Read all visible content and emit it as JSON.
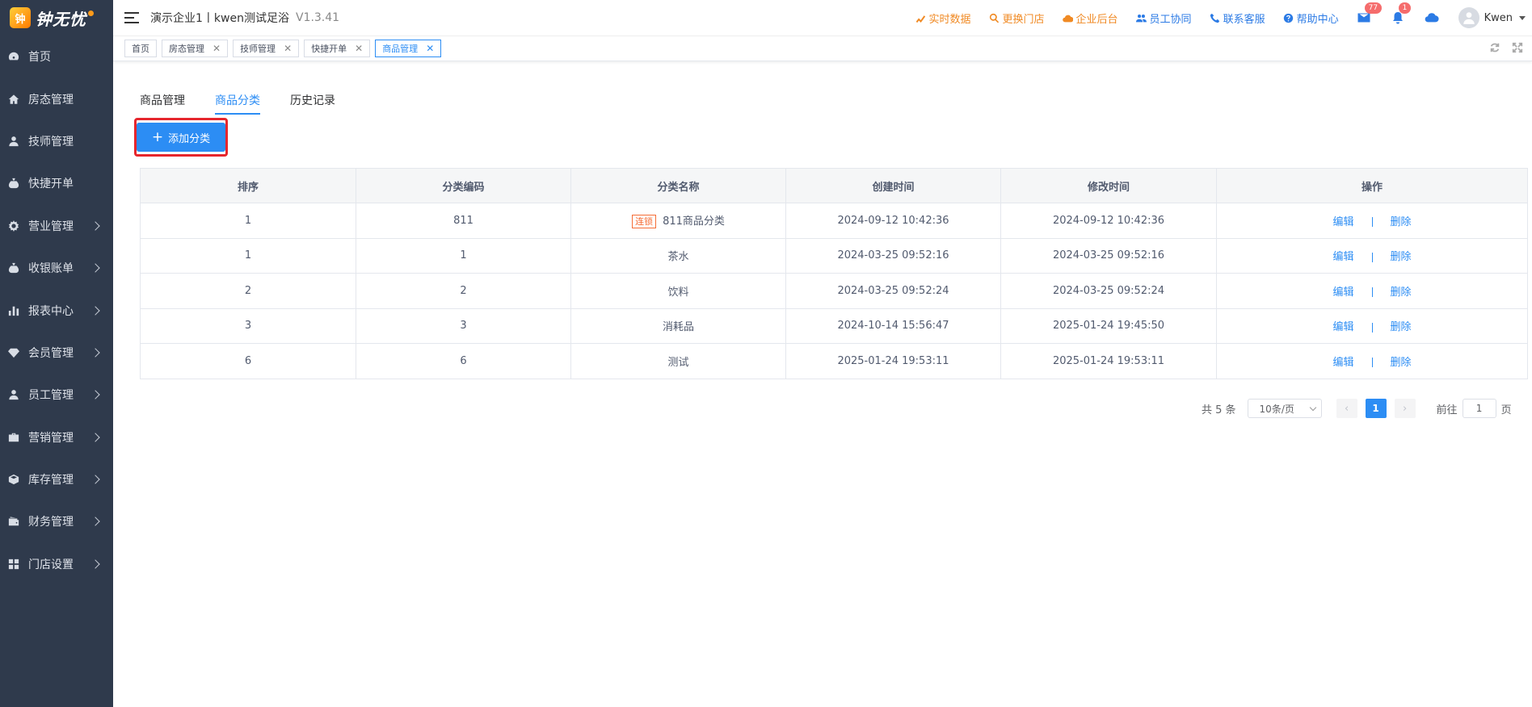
{
  "brand": {
    "logo_badge": "钟",
    "name": "钟无忧"
  },
  "sidebar": {
    "items": [
      {
        "label": "首页",
        "icon": "dashboard-icon",
        "has_submenu": false
      },
      {
        "label": "房态管理",
        "icon": "home-icon",
        "has_submenu": false
      },
      {
        "label": "技师管理",
        "icon": "user-icon",
        "has_submenu": false
      },
      {
        "label": "快捷开单",
        "icon": "bag-icon",
        "has_submenu": false
      },
      {
        "label": "营业管理",
        "icon": "gear-icon",
        "has_submenu": true
      },
      {
        "label": "收银账单",
        "icon": "money-bag-icon",
        "has_submenu": true
      },
      {
        "label": "报表中心",
        "icon": "bar-chart-icon",
        "has_submenu": true
      },
      {
        "label": "会员管理",
        "icon": "diamond-icon",
        "has_submenu": true
      },
      {
        "label": "员工管理",
        "icon": "staff-icon",
        "has_submenu": true
      },
      {
        "label": "营销管理",
        "icon": "briefcase-icon",
        "has_submenu": true
      },
      {
        "label": "库存管理",
        "icon": "box-icon",
        "has_submenu": true
      },
      {
        "label": "财务管理",
        "icon": "wallet-icon",
        "has_submenu": true
      },
      {
        "label": "门店设置",
        "icon": "grid-icon",
        "has_submenu": true
      }
    ]
  },
  "header": {
    "company": "演示企业1丨kwen测试足浴",
    "version": "V1.3.41",
    "links": [
      {
        "label": "实时数据",
        "icon": "realtime-chart-icon",
        "color": "#f08a24"
      },
      {
        "label": "更换门店",
        "icon": "search-icon",
        "color": "#f08a24"
      },
      {
        "label": "企业后台",
        "icon": "cloud-icon",
        "color": "#f08a24"
      },
      {
        "label": "员工协同",
        "icon": "team-icon",
        "color": "#2c7be5"
      },
      {
        "label": "联系客服",
        "icon": "phone-icon",
        "color": "#2c7be5"
      },
      {
        "label": "帮助中心",
        "icon": "help-icon",
        "color": "#2c7be5"
      }
    ],
    "mail_count": "77",
    "notice_count": "1",
    "username": "Kwen"
  },
  "visited_tabs": [
    {
      "label": "首页",
      "closable": false,
      "active": false
    },
    {
      "label": "房态管理",
      "closable": true,
      "active": false
    },
    {
      "label": "技师管理",
      "closable": true,
      "active": false
    },
    {
      "label": "快捷开单",
      "closable": true,
      "active": false
    },
    {
      "label": "商品管理",
      "closable": true,
      "active": true
    }
  ],
  "tabs": [
    {
      "label": "商品管理",
      "active": false
    },
    {
      "label": "商品分类",
      "active": true
    },
    {
      "label": "历史记录",
      "active": false
    }
  ],
  "add_button": "添加分类",
  "table": {
    "columns": [
      "排序",
      "分类编码",
      "分类名称",
      "创建时间",
      "修改时间",
      "操作"
    ],
    "rows": [
      {
        "sort": "1",
        "code": "811",
        "tag": "连锁",
        "name": "811商品分类",
        "created": "2024-09-12 10:42:36",
        "modified": "2024-09-12 10:42:36"
      },
      {
        "sort": "1",
        "code": "1",
        "tag": "",
        "name": "茶水",
        "created": "2024-03-25 09:52:16",
        "modified": "2024-03-25 09:52:16"
      },
      {
        "sort": "2",
        "code": "2",
        "tag": "",
        "name": "饮料",
        "created": "2024-03-25 09:52:24",
        "modified": "2024-03-25 09:52:24"
      },
      {
        "sort": "3",
        "code": "3",
        "tag": "",
        "name": "消耗品",
        "created": "2024-10-14 15:56:47",
        "modified": "2025-01-24 19:45:50"
      },
      {
        "sort": "6",
        "code": "6",
        "tag": "",
        "name": "测试",
        "created": "2025-01-24 19:53:11",
        "modified": "2025-01-24 19:53:11"
      }
    ],
    "edit_label": "编辑",
    "delete_label": "删除"
  },
  "pagination": {
    "total_text": "共 5 条",
    "page_size": "10条/页",
    "current_page": "1",
    "goto_prefix": "前往",
    "goto_value": "1",
    "goto_suffix": "页"
  },
  "colors": {
    "primary": "#2c8df4",
    "sidebar_bg": "#2f3a4c",
    "highlight_border": "#e6262d",
    "chain_tag": "#f56c35",
    "badge": "#f56c6c"
  }
}
